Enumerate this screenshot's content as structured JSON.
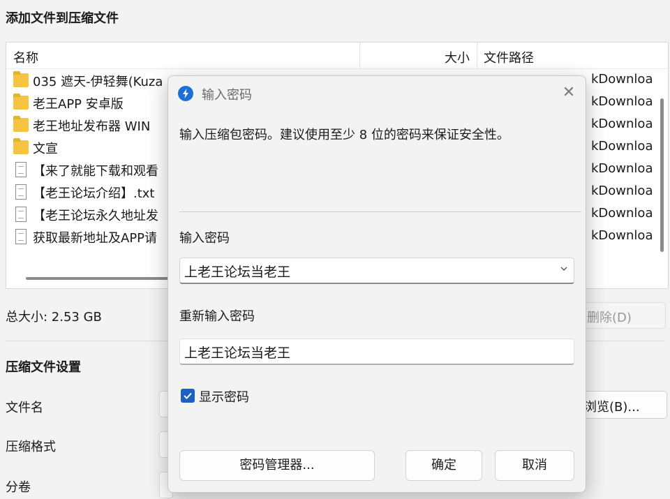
{
  "window": {
    "title": "添加文件到压缩文件"
  },
  "file_list": {
    "columns": {
      "name": "名称",
      "size": "大小",
      "path": "文件路径"
    },
    "rows": [
      {
        "name": "035 遮天-伊轻舞(Kuza",
        "type": "folder",
        "path_fragment": "kDownloa"
      },
      {
        "name": "老王APP 安卓版",
        "type": "folder",
        "path_fragment": "kDownloa"
      },
      {
        "name": "老王地址发布器 WIN",
        "type": "folder",
        "path_fragment": "kDownloa"
      },
      {
        "name": "文宣",
        "type": "folder",
        "path_fragment": "kDownloa"
      },
      {
        "name": "【来了就能下载和观看",
        "type": "file",
        "path_fragment": "kDownloa"
      },
      {
        "name": "【老王论坛介绍】.txt",
        "type": "file",
        "path_fragment": "kDownloa"
      },
      {
        "name": "【老王论坛永久地址发",
        "type": "file",
        "path_fragment": "kDownloa"
      },
      {
        "name": "获取最新地址及APP请",
        "type": "file",
        "path_fragment": "kDownloa"
      }
    ]
  },
  "total_size": "总大小: 2.53 GB",
  "delete_label": "删除(D)",
  "settings": {
    "title": "压缩文件设置",
    "filename_label": "文件名",
    "format_label": "压缩格式",
    "volume_label": "分卷",
    "browse_label": "浏览(B)..."
  },
  "dialog": {
    "title": "输入密码",
    "description": "输入压缩包密码。建议使用至少 8 位的密码来保证安全性。",
    "password_label": "输入密码",
    "password_value": "上老王论坛当老王",
    "reenter_label": "重新输入密码",
    "reenter_value": "上老王论坛当老王",
    "show_password_label": "显示密码",
    "show_password_checked": true,
    "manager_label": "密码管理器...",
    "ok_label": "确定",
    "cancel_label": "取消",
    "accent_color": "#1d5fc4"
  }
}
